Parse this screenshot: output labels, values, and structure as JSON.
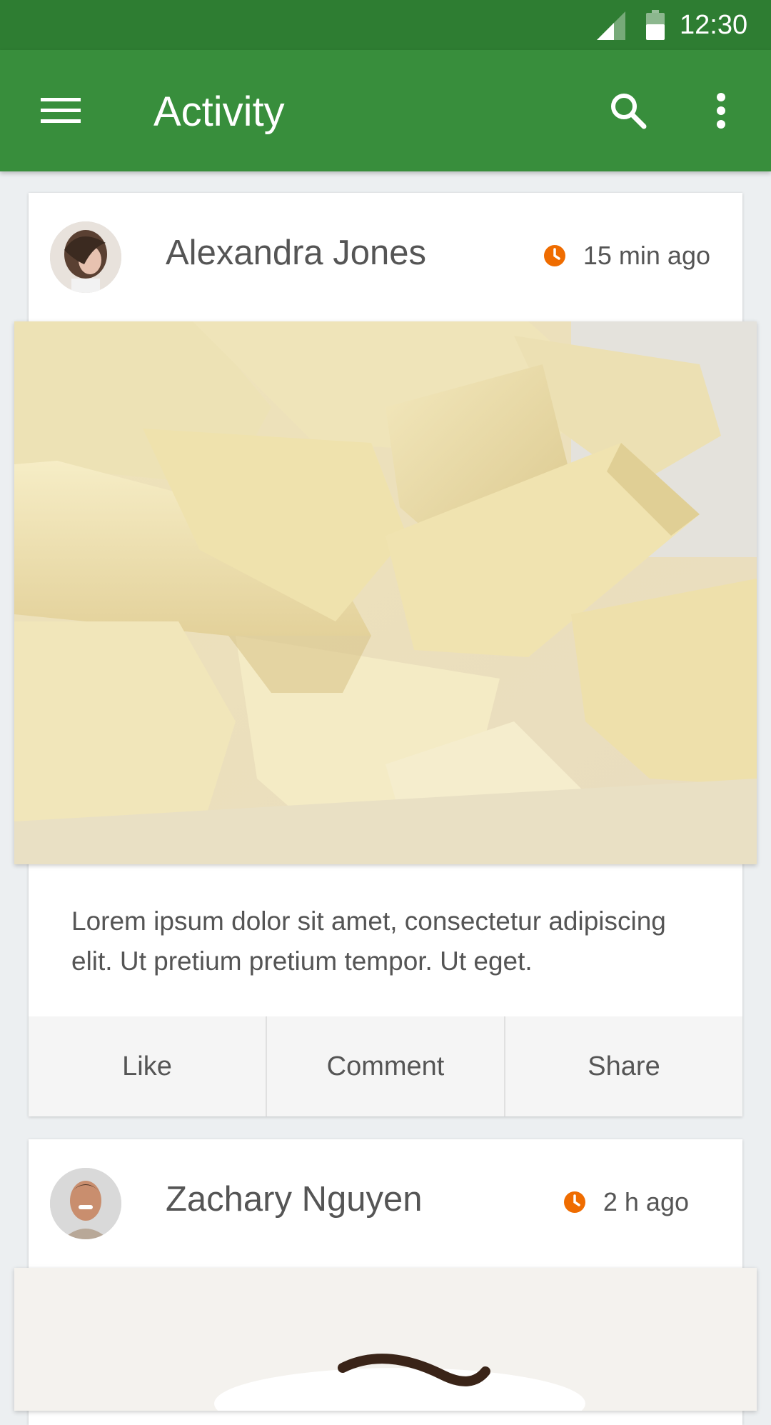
{
  "status_bar": {
    "time": "12:30",
    "icons": [
      "cellular-signal-icon",
      "battery-icon"
    ]
  },
  "app_bar": {
    "title": "Activity",
    "icons": [
      "menu-icon",
      "search-icon",
      "more-vert-icon"
    ]
  },
  "colors": {
    "primary": "#388e3c",
    "primary_dark": "#2e7d32",
    "accent": "#ef6c00",
    "background": "#eceff1"
  },
  "posts": [
    {
      "author": "Alexandra Jones",
      "time": "15 min ago",
      "text": "Lorem ipsum dolor sit amet, consectetur adipiscing elit. Ut pretium pretium tempor. Ut eget.",
      "actions": [
        "Like",
        "Comment",
        "Share"
      ]
    },
    {
      "author": "Zachary Nguyen",
      "time": "2 h ago"
    }
  ]
}
